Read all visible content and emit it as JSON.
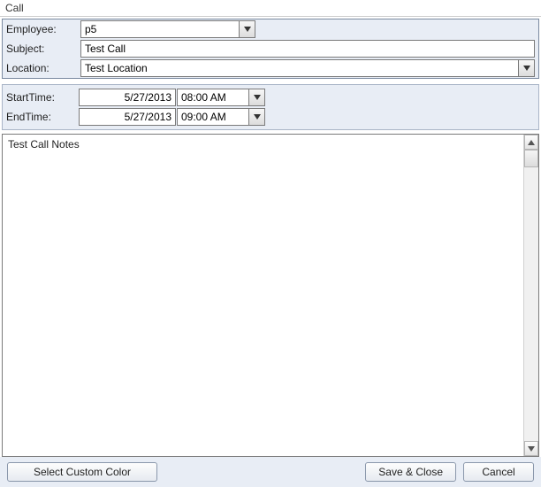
{
  "window_title": "Call",
  "labels": {
    "employee": "Employee:",
    "subject": "Subject:",
    "location": "Location:",
    "start_time": "StartTime:",
    "end_time": "EndTime:"
  },
  "fields": {
    "employee": "p5",
    "subject": "Test Call",
    "location": "Test Location",
    "start_date": "5/27/2013",
    "start_time": "08:00 AM",
    "end_date": "5/27/2013",
    "end_time": "09:00 AM",
    "notes": "Test Call Notes"
  },
  "buttons": {
    "select_custom_color": "Select Custom Color",
    "save_close": "Save & Close",
    "cancel": "Cancel"
  }
}
